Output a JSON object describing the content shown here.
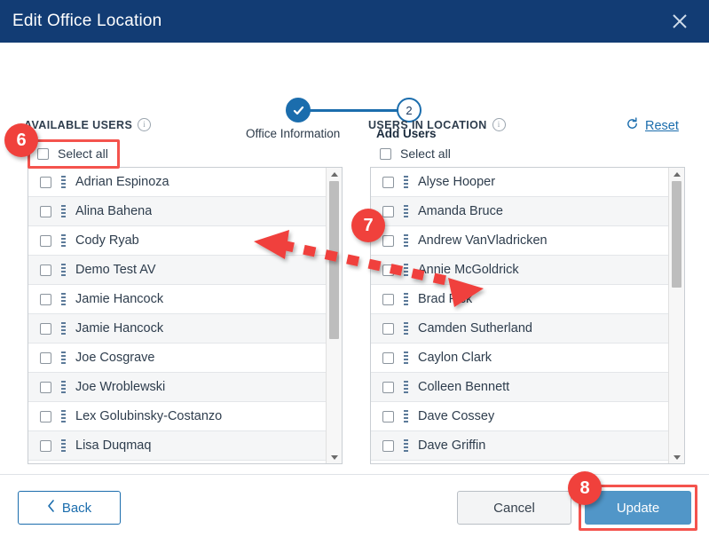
{
  "window": {
    "title": "Edit Office Location",
    "close_icon": "close-icon"
  },
  "stepper": {
    "steps": [
      {
        "label": "Office Information",
        "state": "completed",
        "marker": "✓"
      },
      {
        "label": "Add Users",
        "state": "current",
        "marker": "2"
      }
    ]
  },
  "panels": {
    "available": {
      "header": "AVAILABLE USERS",
      "info_icon": "info-icon",
      "select_all_label": "Select all",
      "select_all_checked": false,
      "users": [
        "Adrian Espinoza",
        "Alina Bahena",
        "Cody Ryab",
        "Demo Test AV",
        "Jamie Hancock",
        "Jamie Hancock",
        "Joe Cosgrave",
        "Joe Wroblewski",
        "Lex Golubinsky-Costanzo",
        "Lisa Duqmaq"
      ]
    },
    "in_location": {
      "header": "USERS IN LOCATION",
      "info_icon": "info-icon",
      "select_all_label": "Select all",
      "select_all_checked": false,
      "reset_label": "Reset",
      "reset_icon": "refresh-icon",
      "users": [
        "Alyse Hooper",
        "Amanda Bruce",
        "Andrew VanVladricken",
        "Annie McGoldrick",
        "Brad Fisk",
        "Camden Sutherland",
        "Caylon Clark",
        "Colleen Bennett",
        "Dave Cossey",
        "Dave Griffin"
      ]
    }
  },
  "footer": {
    "back_label": "Back",
    "back_icon": "chevron-left-icon",
    "cancel_label": "Cancel",
    "update_label": "Update"
  },
  "annotations": {
    "badges": [
      {
        "number": "6",
        "target": "select-all-available"
      },
      {
        "number": "7",
        "target": "users-transfer-arrow"
      },
      {
        "number": "8",
        "target": "update-button"
      }
    ],
    "highlight_color": "#f0413c"
  },
  "colors": {
    "titlebar": "#123c74",
    "accent": "#1b6dad",
    "update_button": "#5196c8",
    "annotation_red": "#f0413c"
  }
}
